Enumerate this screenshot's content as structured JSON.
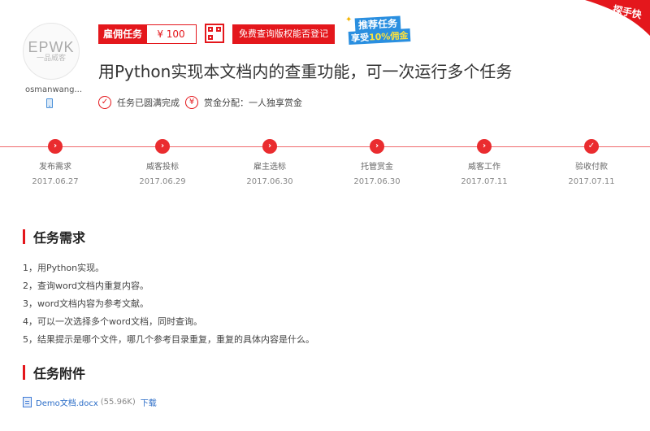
{
  "header": {
    "avatar_logo": "EPWK",
    "avatar_logo_sub": "一品威客",
    "username": "osmanwang...",
    "task_type": "雇佣任务",
    "price": "¥ 100",
    "free_query_label": "免费查询版权能否登记",
    "promo_line1": "推荐任务",
    "promo_line2a": "享受",
    "promo_line2b": "10%佣金",
    "corner_label": "探手快",
    "title": "用Python实现本文档内的查重功能，可一次运行多个任务",
    "status_text": "任务已圆满完成",
    "reward_text": "赏金分配：一人独享赏金"
  },
  "timeline": [
    {
      "label": "发布需求",
      "date": "2017.06.27",
      "mark": "›"
    },
    {
      "label": "威客投标",
      "date": "2017.06.29",
      "mark": "›"
    },
    {
      "label": "雇主选标",
      "date": "2017.06.30",
      "mark": "›"
    },
    {
      "label": "托管赏金",
      "date": "2017.06.30",
      "mark": "›"
    },
    {
      "label": "威客工作",
      "date": "2017.07.11",
      "mark": "›"
    },
    {
      "label": "验收付款",
      "date": "2017.07.11",
      "mark": "✓"
    }
  ],
  "requirements": {
    "heading": "任务需求",
    "items": [
      "1，用Python实现。",
      "2，查询word文档内重复内容。",
      "3，word文档内容为参考文献。",
      "4，可以一次选择多个word文档，同时查询。",
      "5，结果提示是哪个文件，哪几个参考目录重复，重复的具体内容是什么。"
    ]
  },
  "attachments": {
    "heading": "任务附件",
    "file_name": "Demo文档.docx",
    "file_size": "(55.96K)",
    "download_label": "下载"
  },
  "colors": {
    "accent": "#e4171c",
    "promo_blue": "#2a8fe0",
    "link": "#2a6cc7"
  }
}
